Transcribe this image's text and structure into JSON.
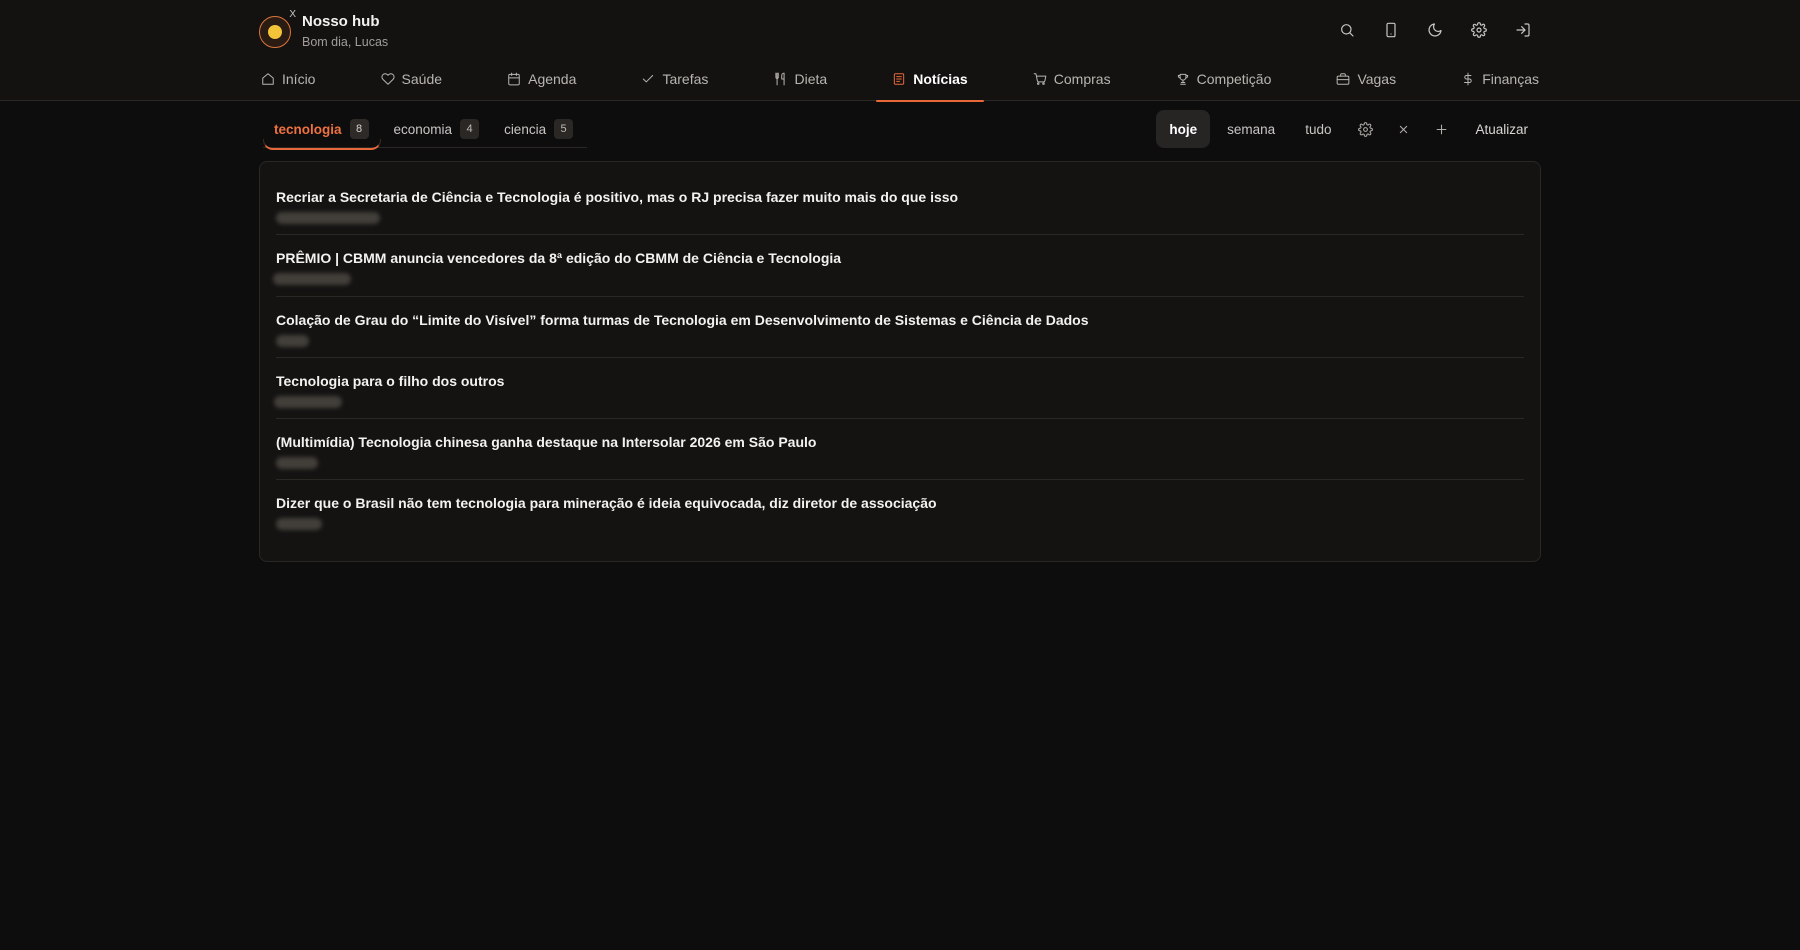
{
  "app": {
    "title": "Nosso hub",
    "greeting": "Bom dia, Lucas",
    "avatar_mark": "X"
  },
  "header_actions": [
    {
      "name": "search-icon"
    },
    {
      "name": "mobile-icon"
    },
    {
      "name": "moon-icon"
    },
    {
      "name": "gear-icon"
    },
    {
      "name": "logout-icon"
    }
  ],
  "nav": [
    {
      "label": "Início",
      "icon": "home-icon"
    },
    {
      "label": "Saúde",
      "icon": "heart-icon"
    },
    {
      "label": "Agenda",
      "icon": "calendar-icon"
    },
    {
      "label": "Tarefas",
      "icon": "check-icon"
    },
    {
      "label": "Dieta",
      "icon": "utensils-icon"
    },
    {
      "label": "Notícias",
      "icon": "newspaper-icon",
      "active": true
    },
    {
      "label": "Compras",
      "icon": "cart-icon"
    },
    {
      "label": "Competição",
      "icon": "trophy-icon"
    },
    {
      "label": "Vagas",
      "icon": "briefcase-icon"
    },
    {
      "label": "Finanças",
      "icon": "dollar-icon"
    }
  ],
  "topics": [
    {
      "label": "tecnologia",
      "count": "8",
      "active": true
    },
    {
      "label": "economia",
      "count": "4"
    },
    {
      "label": "ciencia",
      "count": "5"
    }
  ],
  "filters": {
    "today": "hoje",
    "week": "semana",
    "all": "tudo",
    "refresh": "Atualizar"
  },
  "news": [
    {
      "title": "Recriar a Secretaria de Ciência e Tecnologia é positivo, mas o RJ precisa fazer muito mais do que isso"
    },
    {
      "title": "PRÊMIO | CBMM anuncia vencedores da 8ª edição do CBMM de Ciência e Tecnologia"
    },
    {
      "title": "Colação de Grau do “Limite do Visível” forma turmas de Tecnologia em Desenvolvimento de Sistemas e Ciência de Dados"
    },
    {
      "title": "Tecnologia para o filho dos outros"
    },
    {
      "title": "(Multimídia) Tecnologia chinesa ganha destaque na Intersolar 2026 em São Paulo"
    },
    {
      "title": "Dizer que o Brasil não tem tecnologia para mineração é ideia equivocada, diz diretor de associação"
    }
  ],
  "colors": {
    "accent": "#e7693a",
    "background": "#0e0d0d",
    "card": "#141312"
  }
}
